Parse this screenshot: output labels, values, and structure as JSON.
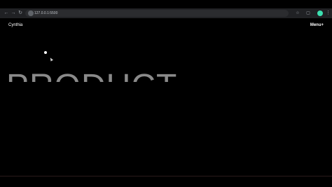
{
  "browser": {
    "url": "127.0.0.1:5500",
    "back_icon": "back-arrow-icon",
    "forward_icon": "forward-arrow-icon",
    "reload_icon": "reload-icon"
  },
  "site": {
    "brand": "Cynthia",
    "menu_label": "Menu+",
    "hero_text": "PRODUCT"
  }
}
